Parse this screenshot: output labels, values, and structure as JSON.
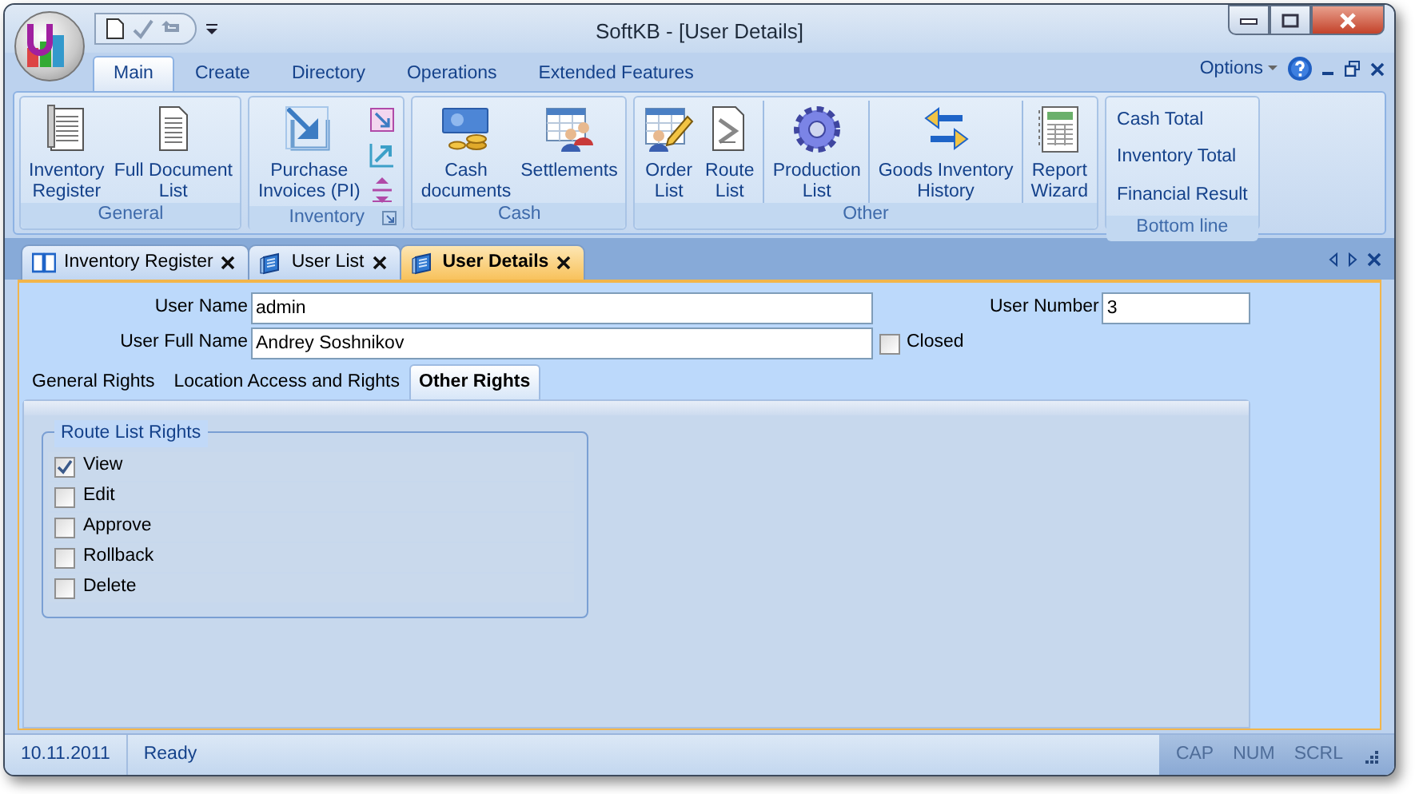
{
  "window": {
    "title": "SoftKB - [User Details]"
  },
  "ribbon": {
    "tabs": [
      {
        "label": "Main",
        "selected": true
      },
      {
        "label": "Create",
        "selected": false
      },
      {
        "label": "Directory",
        "selected": false
      },
      {
        "label": "Operations",
        "selected": false
      },
      {
        "label": "Extended Features",
        "selected": false
      }
    ],
    "options": "Options",
    "groups": [
      {
        "title": "General",
        "launcher": false,
        "items": [
          {
            "kind": "large",
            "label": "Inventory\nRegister"
          },
          {
            "kind": "large",
            "label": "Full Document\nList"
          }
        ]
      },
      {
        "title": "Inventory",
        "launcher": true,
        "items": [
          {
            "kind": "large",
            "label": "Purchase\nInvoices (PI)"
          },
          {
            "kind": "icon"
          },
          {
            "kind": "icon"
          },
          {
            "kind": "icon"
          }
        ]
      },
      {
        "title": "Cash",
        "launcher": false,
        "items": [
          {
            "kind": "large",
            "label": "Cash\ndocuments"
          },
          {
            "kind": "large",
            "label": "Settlements"
          }
        ]
      },
      {
        "title": "Other",
        "launcher": false,
        "items": [
          {
            "kind": "large",
            "label": "Order\nList",
            "divider": false
          },
          {
            "kind": "large",
            "label": "Route\nList",
            "divider": false
          },
          {
            "kind": "large",
            "label": "Production\nList",
            "divider": true
          },
          {
            "kind": "large",
            "label": "Goods Inventory\nHistory",
            "divider": true
          },
          {
            "kind": "large",
            "label": "Report\nWizard",
            "divider": true
          }
        ]
      },
      {
        "title": "Bottom line",
        "launcher": false,
        "items": [
          {
            "kind": "link",
            "label": "Cash Total"
          },
          {
            "kind": "link",
            "label": "Inventory Total"
          },
          {
            "kind": "link",
            "label": "Financial Result"
          }
        ]
      }
    ]
  },
  "document_tabs": [
    {
      "label": "Inventory Register",
      "selected": false
    },
    {
      "label": "User List",
      "selected": false
    },
    {
      "label": "User Details",
      "selected": true
    }
  ],
  "form": {
    "user_name": {
      "label": "User Name",
      "value": "admin"
    },
    "user_number": {
      "label": "User Number",
      "value": "3"
    },
    "user_full_name": {
      "label": "User Full Name",
      "value": "Andrey Soshnikov"
    },
    "closed": {
      "label": "Closed",
      "checked": false
    },
    "tabs": [
      {
        "label": "General Rights",
        "selected": false
      },
      {
        "label": "Location Access and Rights",
        "selected": false
      },
      {
        "label": "Other Rights",
        "selected": true
      }
    ],
    "group": {
      "title": "Route List Rights",
      "rights": [
        {
          "label": "View",
          "checked": true
        },
        {
          "label": "Edit",
          "checked": false
        },
        {
          "label": "Approve",
          "checked": false
        },
        {
          "label": "Rollback",
          "checked": false
        },
        {
          "label": "Delete",
          "checked": false
        }
      ]
    }
  },
  "status_bar": {
    "date": "10.11.2011",
    "status": "Ready",
    "indicators": [
      {
        "label": "CAP",
        "on": false
      },
      {
        "label": "NUM",
        "on": false
      },
      {
        "label": "SCRL",
        "on": false
      }
    ]
  }
}
